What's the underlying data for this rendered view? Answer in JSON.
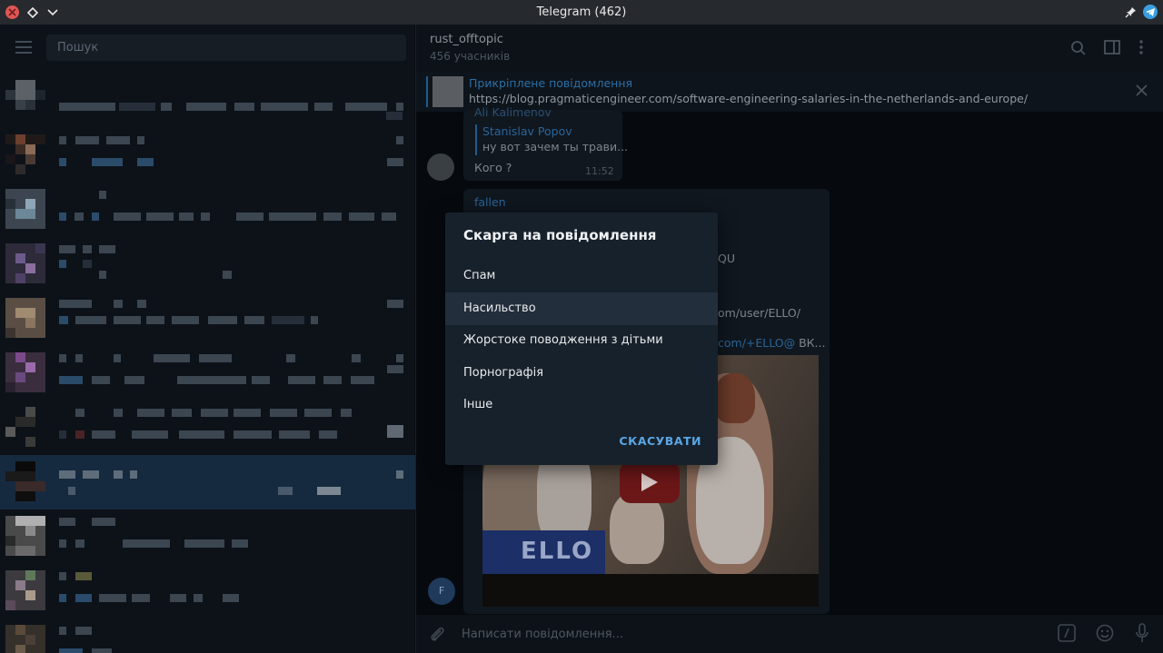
{
  "window": {
    "title": "Telegram (462)"
  },
  "sidebar": {
    "search_placeholder": "Пошук"
  },
  "chat": {
    "title": "rust_offtopic",
    "subtitle": "456 учасників",
    "pinned": {
      "title": "Прикріплене повідомлення",
      "text": "https://blog.pragmaticengineer.com/software-engineering-salaries-in-the-netherlands-and-europe/"
    },
    "messages": [
      {
        "name_partial": "Ali Kalimenov",
        "reply_name": "Stanislav Popov",
        "reply_text": "ну вот зачем ты трави...",
        "text": "Кого ?",
        "time": "11:52"
      },
      {
        "name": "fallen",
        "fragment_1": "QU",
        "fragment_2": "om/user/ELLO/",
        "fragment_3_link": "com/+ELLO@",
        "fragment_3_rest": " ВК...",
        "video_brand": "ELLO",
        "avatar_letter": "F"
      }
    ],
    "composer_placeholder": "Написати повідомлення..."
  },
  "dialog": {
    "title": "Скарга на повідомлення",
    "options": [
      "Спам",
      "Насильство",
      "Жорстоке поводження з дітьми",
      "Порнографія",
      "Інше"
    ],
    "cancel_label": "СКАСУВАТИ"
  },
  "colors": {
    "accent": "#5aa6e5",
    "dialog_bg": "#17212b",
    "active_row": "#162a3f"
  }
}
